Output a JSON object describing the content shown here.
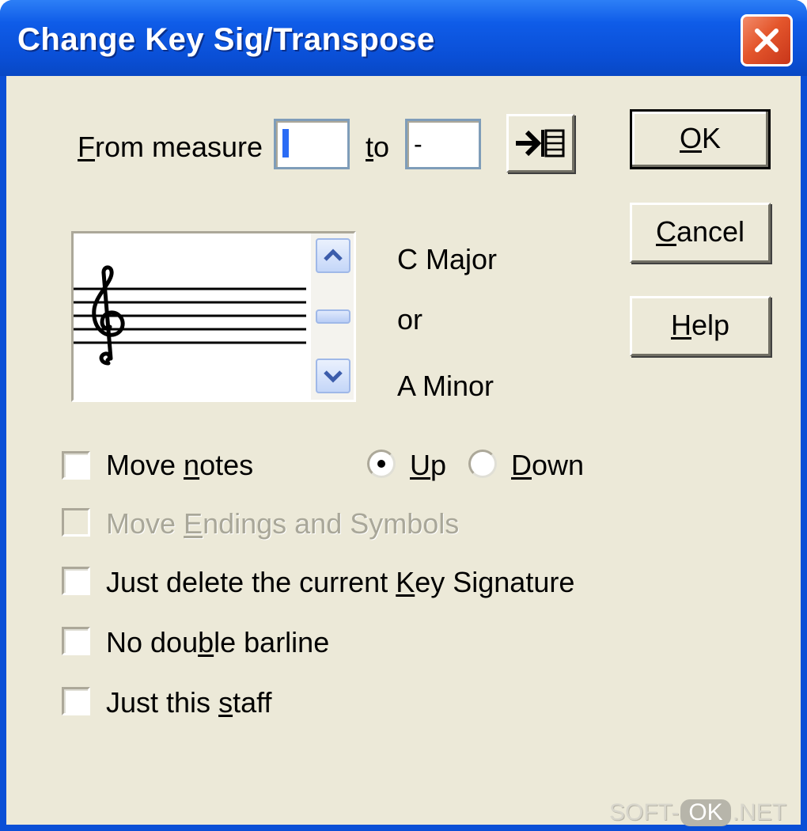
{
  "window": {
    "title": "Change Key Sig/Transpose"
  },
  "measure": {
    "from_label_pre": "",
    "from_label_accel": "F",
    "from_label_post": "rom measure",
    "from_value": "",
    "to_label_accel": "t",
    "to_label_post": "o",
    "to_value": "-"
  },
  "buttons": {
    "ok_accel": "O",
    "ok_post": "K",
    "cancel_accel": "C",
    "cancel_post": "ancel",
    "help_accel": "H",
    "help_post": "elp"
  },
  "key": {
    "major": "C Major",
    "or": "or",
    "minor": "A Minor"
  },
  "options": {
    "move_notes_pre": "Move ",
    "move_notes_accel": "n",
    "move_notes_post": "otes",
    "move_notes_checked": false,
    "direction_up_accel": "U",
    "direction_up_post": "p",
    "direction_down_accel": "D",
    "direction_down_post": "own",
    "direction_selected": "Up",
    "move_endings_pre": "Move ",
    "move_endings_accel": "E",
    "move_endings_post": "ndings and Symbols",
    "move_endings_enabled": false,
    "delete_key_pre": "Just delete the current ",
    "delete_key_accel": "K",
    "delete_key_post": "ey Signature",
    "no_barline_pre": "No dou",
    "no_barline_accel": "b",
    "no_barline_post": "le barline",
    "just_staff_pre": "Just this ",
    "just_staff_accel": "s",
    "just_staff_post": "taff"
  },
  "icons": {
    "jump_to_end": "arrow-to-end-icon",
    "close": "close-icon",
    "treble_clef": "treble-clef-icon",
    "scroll_up": "chevron-up-icon",
    "scroll_down": "chevron-down-icon"
  },
  "watermark": {
    "pre": "SOFT-",
    "ok": "OK",
    "post": ".NET"
  },
  "colors": {
    "title_bar": "#0a4fd6",
    "dialog_bg": "#ece9d8",
    "close_button": "#e4562c"
  }
}
